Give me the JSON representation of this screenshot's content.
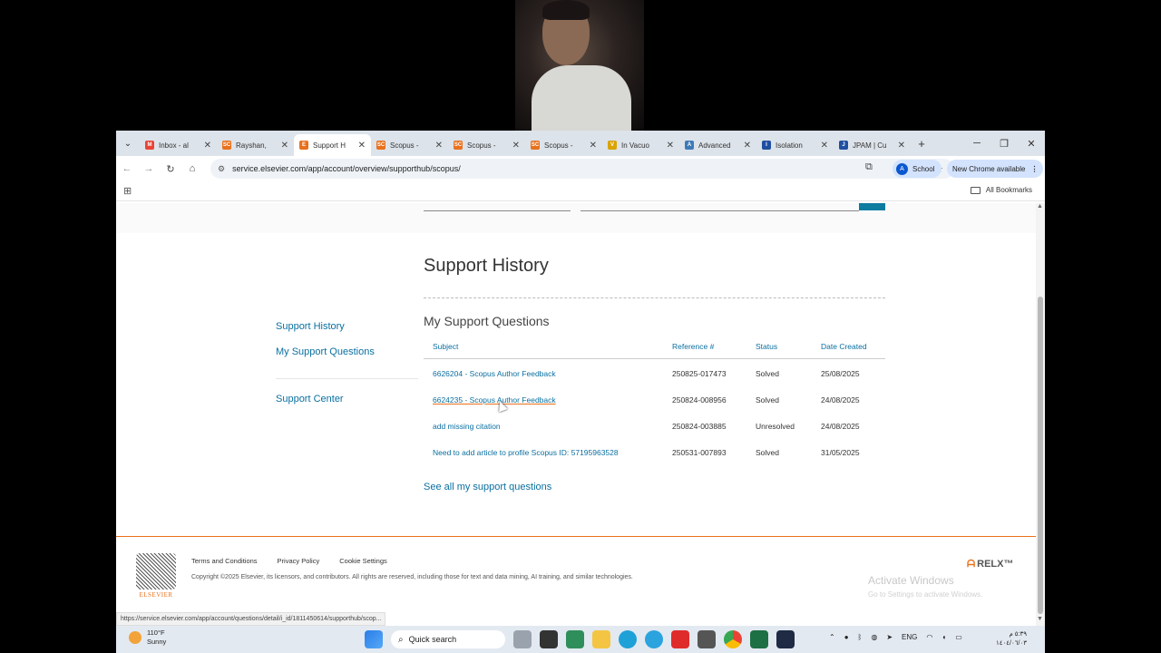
{
  "browser": {
    "tabs": [
      {
        "label": "Inbox - al",
        "fav_color": "#ea4335",
        "fav_text": "M"
      },
      {
        "label": "Rayshan, ",
        "fav_color": "#e9711c",
        "fav_text": "SC"
      },
      {
        "label": "Support H",
        "fav_color": "#e9711c",
        "fav_text": "E",
        "active": true
      },
      {
        "label": "Scopus - ",
        "fav_color": "#e9711c",
        "fav_text": "SC"
      },
      {
        "label": "Scopus - ",
        "fav_color": "#e9711c",
        "fav_text": "SC"
      },
      {
        "label": "Scopus - ",
        "fav_color": "#e9711c",
        "fav_text": "SC"
      },
      {
        "label": "In Vacuo ",
        "fav_color": "#d9a400",
        "fav_text": "V"
      },
      {
        "label": "Advanced",
        "fav_color": "#3d7ab8",
        "fav_text": "A"
      },
      {
        "label": "Isolation ",
        "fav_color": "#1f4fa0",
        "fav_text": "I"
      },
      {
        "label": "JPAM | Cu",
        "fav_color": "#1f4fa0",
        "fav_text": "J"
      }
    ],
    "tab_close": "✕",
    "new_tab": "+",
    "window_controls": {
      "minimize": "─",
      "restore": "❐",
      "close": "✕"
    },
    "nav": {
      "back": "←",
      "forward": "→",
      "reload": "↻",
      "home": "⌂"
    },
    "url": "service.elsevier.com/app/account/overview/supporthub/scopus/",
    "profile": {
      "initial": "A",
      "label": "School"
    },
    "new_chrome": "New Chrome available",
    "all_bookmarks": "All Bookmarks"
  },
  "page": {
    "title": "Support History",
    "sidebar": [
      {
        "label": "Support History"
      },
      {
        "label": "My Support Questions"
      },
      {
        "label": "Support Center"
      }
    ],
    "section_title": "My Support Questions",
    "table": {
      "headers": [
        "Subject",
        "Reference #",
        "Status",
        "Date Created"
      ],
      "rows": [
        [
          "6626204 - Scopus Author Feedback",
          "250825-017473",
          "Solved",
          "25/08/2025"
        ],
        [
          "6624235 - Scopus Author Feedback",
          "250824-008956",
          "Solved",
          "24/08/2025"
        ],
        [
          "add missing citation",
          "250824-003885",
          "Unresolved",
          "24/08/2025"
        ],
        [
          "Need to add article to profile Scopus ID: 57195963528",
          "250531-007893",
          "Solved",
          "31/05/2025"
        ]
      ]
    },
    "see_all": "See all my support questions"
  },
  "footer": {
    "logo_text": "ELSEVIER",
    "links": [
      "Terms and Conditions",
      "Privacy Policy",
      "Cookie Settings"
    ],
    "copyright": "Copyright ©2025 Elsevier, its licensors, and contributors. All rights are reserved, including those for text and data mining, AI training, and similar technologies.",
    "relx": "RELX™",
    "watermark_title": "Activate Windows",
    "watermark_sub": "Go to Settings to activate Windows."
  },
  "status_url": "https://service.elsevier.com/app/account/questions/detail/i_id/1811450614/supporthub/scop...",
  "taskbar": {
    "weather_temp": "110°F",
    "weather_desc": "Sunny",
    "search": "Quick search",
    "tray_lang": "ENG",
    "clock_time": "٥:٣٩ م",
    "clock_date": "١٤٠٤/٠٦/٠٣"
  }
}
